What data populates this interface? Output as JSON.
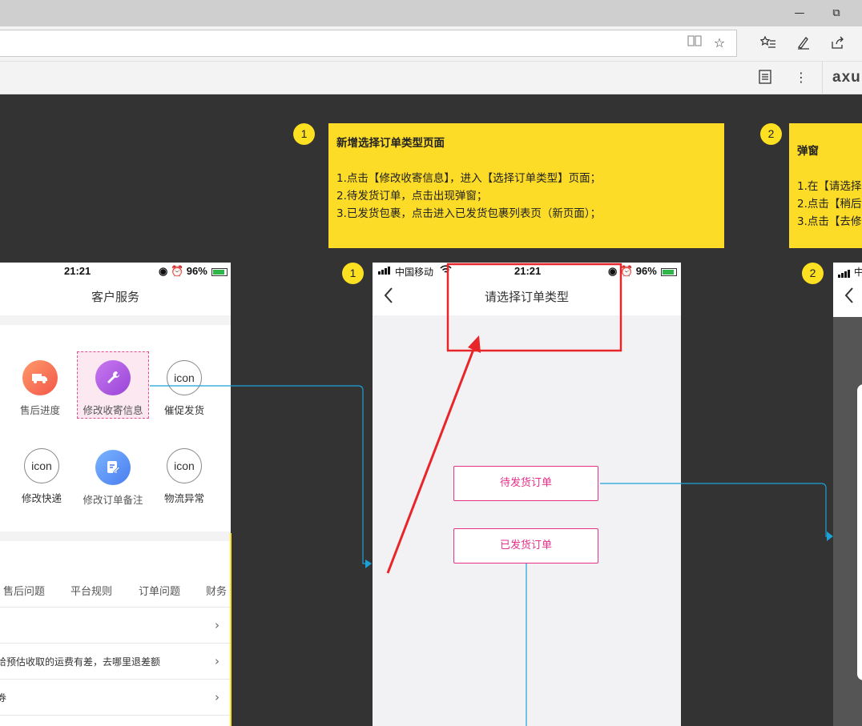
{
  "browser": {
    "icons": [
      "minimize-icon",
      "restore-icon",
      "reading-view-icon",
      "favorite-star-icon",
      "favorites-hub-icon",
      "pen-icon",
      "share-icon",
      "reader-icon",
      "more-icon"
    ],
    "extension_label": "axu"
  },
  "notes": [
    {
      "badge": "1",
      "title": "新增选择订单类型页面",
      "lines": [
        "1.点击【修改收寄信息】，进入【选择订单类型】页面；",
        "2.待发货订单，点击出现弹窗；",
        "3.已发货包裹，点击进入已发货包裹列表页（新页面）；"
      ]
    },
    {
      "badge": "2",
      "title": "弹窗",
      "lines": [
        "1.在【请选择",
        "2.点击【稍后",
        "3.点击【去修"
      ]
    }
  ],
  "left_phone": {
    "time": "21:21",
    "battery": "96%",
    "title": "客户服务",
    "functions": [
      {
        "label": "售后进度",
        "icon": "truck-icon"
      },
      {
        "label": "修改收寄信息",
        "icon": "wrench-icon"
      },
      {
        "label": "催促发货",
        "icon_text": "icon"
      },
      {
        "label": "修改快递",
        "icon_text": "icon"
      },
      {
        "label": "修改订单备注",
        "icon": "edit-note-icon"
      },
      {
        "label": "物流异常",
        "icon_text": "icon"
      }
    ],
    "tabs": [
      "售后问题",
      "平台规则",
      "订单问题",
      "财务"
    ],
    "faq": [
      "",
      "给预估收取的运费有差，去哪里退差额",
      "券"
    ]
  },
  "mid_phone": {
    "badge": "1",
    "carrier": "中国移动",
    "time": "21:21",
    "battery": "96%",
    "title": "请选择订单类型",
    "buttons": [
      "待发货订单",
      "已发货订单"
    ]
  },
  "right_phone": {
    "badge": "2",
    "carrier": "中"
  },
  "colors": {
    "note_yellow": "#fddc27",
    "accent_pink": "#e6308a",
    "link_blue": "#1ba1d6",
    "highlight_red": "#e8262a"
  }
}
